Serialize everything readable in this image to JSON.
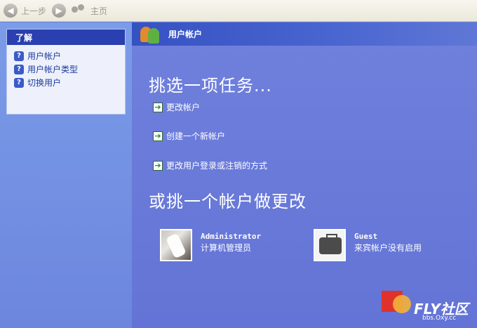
{
  "toolbar": {
    "back_label": "上一步",
    "home_label": "主页"
  },
  "left_panel": {
    "heading": "了解",
    "items": [
      {
        "label": "用户帐户"
      },
      {
        "label": "用户帐户类型"
      },
      {
        "label": "切换用户"
      }
    ]
  },
  "main": {
    "header_title": "用户帐户",
    "pick_task_heading": "挑选一项任务...",
    "tasks": [
      {
        "label": "更改帐户"
      },
      {
        "label": "创建一个新帐户"
      },
      {
        "label": "更改用户登录或注销的方式"
      }
    ],
    "pick_account_heading": "或挑一个帐户做更改",
    "accounts": [
      {
        "name": "Administrator",
        "description": "计算机管理员"
      },
      {
        "name": "Guest",
        "description": "来宾帐户没有启用"
      }
    ]
  },
  "watermark": {
    "logo_text": "FLY社区",
    "url": "bbs.Oxy.cc"
  }
}
